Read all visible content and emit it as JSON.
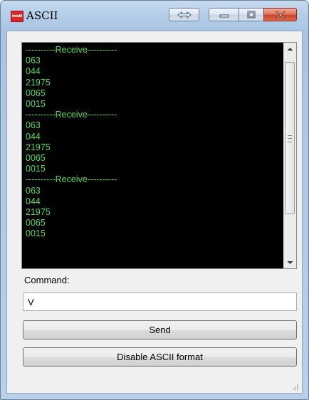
{
  "window": {
    "title": "ASCII",
    "app_icon_text": "intelli"
  },
  "console": {
    "lines": [
      "----------Receive----------",
      "063",
      "044",
      "21975",
      "0065",
      "0015",
      "----------Receive----------",
      "063",
      "044",
      "21975",
      "0065",
      "0015",
      "----------Receive----------",
      "063",
      "044",
      "21975",
      "0065",
      "0015"
    ],
    "scroll_position": 0.15
  },
  "command": {
    "label": "Command:",
    "value": "V"
  },
  "buttons": {
    "send": "Send",
    "toggle_format": "Disable ASCII format"
  },
  "colors": {
    "console_bg": "#000000",
    "console_text": "#4edb5a",
    "close_button": "#c9452b"
  }
}
